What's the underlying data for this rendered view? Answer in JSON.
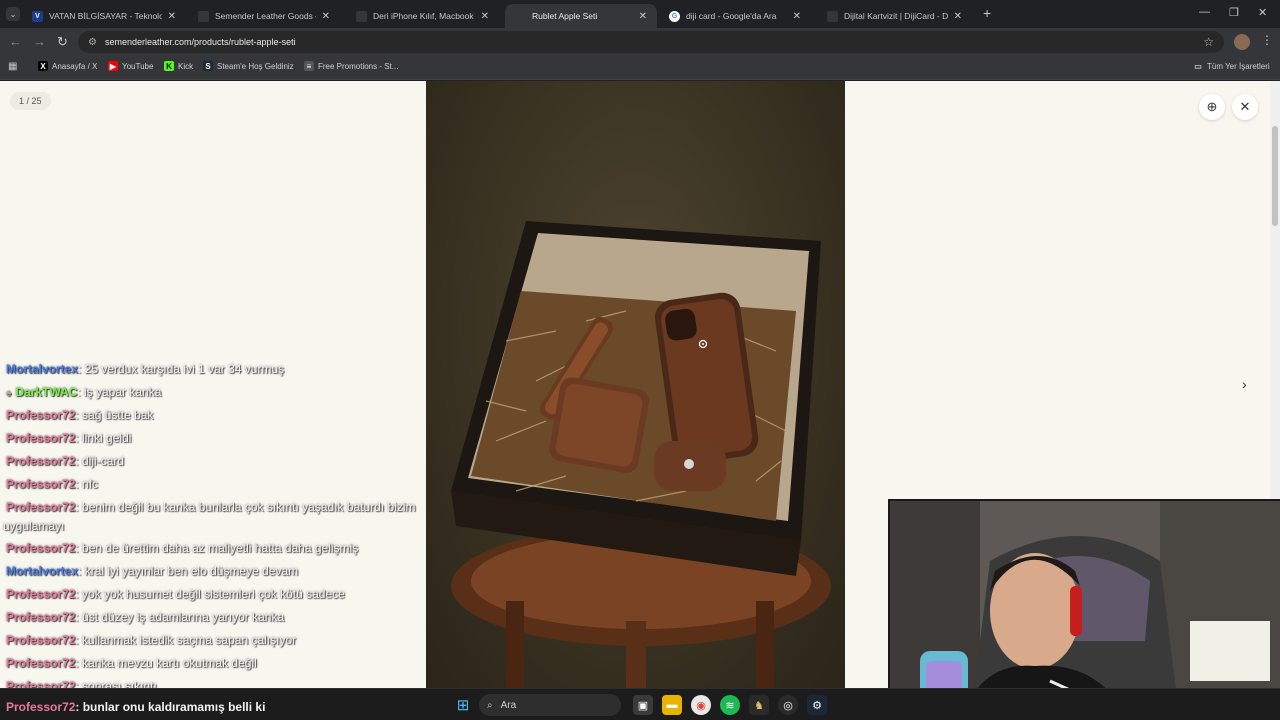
{
  "tabs": [
    {
      "title": "VATAN BİLGİSAYAR - Teknoloji Z",
      "fav_color": "#1e3a8a",
      "fav_char": "V",
      "active": false
    },
    {
      "title": "Semender Leather Goods – Sem",
      "fav_color": "#35363a",
      "fav_char": "",
      "active": false
    },
    {
      "title": "Deri iPhone Kılıf, Macbook Kılıf",
      "fav_color": "#35363a",
      "fav_char": "",
      "active": false
    },
    {
      "title": "Rublet Apple Seti",
      "fav_color": "#35363a",
      "fav_char": "",
      "active": true
    },
    {
      "title": "diji card - Google'da Ara",
      "fav_color": "#ffffff",
      "fav_char": "G",
      "active": false
    },
    {
      "title": "Dijital Kartvizit | DijiCard - Diji C",
      "fav_color": "#35363a",
      "fav_char": "",
      "active": false
    }
  ],
  "new_tab_label": "+",
  "url": "semenderleather.com/products/rublet-apple-seti",
  "bookmarks": [
    {
      "label": "Anasayfa / X",
      "icon": "x-icon",
      "char": "X",
      "color": "#000000"
    },
    {
      "label": "YouTube",
      "icon": "youtube-icon",
      "char": "▶",
      "color": "#ff0000"
    },
    {
      "label": "Kick",
      "icon": "kick-icon",
      "char": "K",
      "color": "#53fc18"
    },
    {
      "label": "Steam'e Hoş Geldiniz",
      "icon": "steam-icon",
      "char": "S",
      "color": "#1b2838"
    },
    {
      "label": "Free Promotions - St...",
      "icon": "stack-icon",
      "char": "≡",
      "color": "#555555"
    }
  ],
  "all_bookmarks_label": "Tüm Yer İşaretleri",
  "gallery": {
    "counter": "1 / 25"
  },
  "chat": [
    {
      "user": "Mortalvortex",
      "text": ": 25 verdux karşıda ivi 1 var 34 vurmuş",
      "color": "#4a7be8"
    },
    {
      "user": "DarkTWAC",
      "text": ": iş yapar kanka",
      "color": "#7cf04a"
    },
    {
      "user": "Professor72",
      "text": ": sağ üstte bak",
      "color": "#e67a9a"
    },
    {
      "user": "Professor72",
      "text": ": linki geldi",
      "color": "#e67a9a"
    },
    {
      "user": "Professor72",
      "text": ": diji-card",
      "color": "#e67a9a"
    },
    {
      "user": "Professor72",
      "text": ": nfc",
      "color": "#e67a9a"
    },
    {
      "user": "Professor72",
      "text": ": benim değil bu kanka bunlarla çok sıkıntı yaşadık baturdı bizim",
      "color": "#e67a9a"
    },
    {
      "user": "",
      "text": "uygulamayı",
      "color": "#e67a9a"
    },
    {
      "user": "Professor72",
      "text": ": ben de ürettim daha az maliyetli hatta daha gelişmiş",
      "color": "#e67a9a"
    },
    {
      "user": "Mortalvortex",
      "text": ": kral iyi yayınlar ben elo düşmeye devam",
      "color": "#4a7be8"
    },
    {
      "user": "Professor72",
      "text": ": yok yok husumet değil sistemleri çok kötü sadece",
      "color": "#e67a9a"
    },
    {
      "user": "Professor72",
      "text": ": üst düzey iş adamlarına yarıyor kanka",
      "color": "#e67a9a"
    },
    {
      "user": "Professor72",
      "text": ": kullanmak istedik saçma sapan çalışıyor",
      "color": "#e67a9a"
    },
    {
      "user": "Professor72",
      "text": ": kanka mevzu kartı okutmak değil",
      "color": "#e67a9a"
    },
    {
      "user": "Professor72",
      "text": ": sonrası sıkıntı",
      "color": "#e67a9a"
    }
  ],
  "bottom_chat": {
    "user": "Professor72",
    "text": ": bunlar onu kaldıramamış belli ki",
    "color": "#e67a9a"
  },
  "taskbar": {
    "search_label": "Ara"
  }
}
